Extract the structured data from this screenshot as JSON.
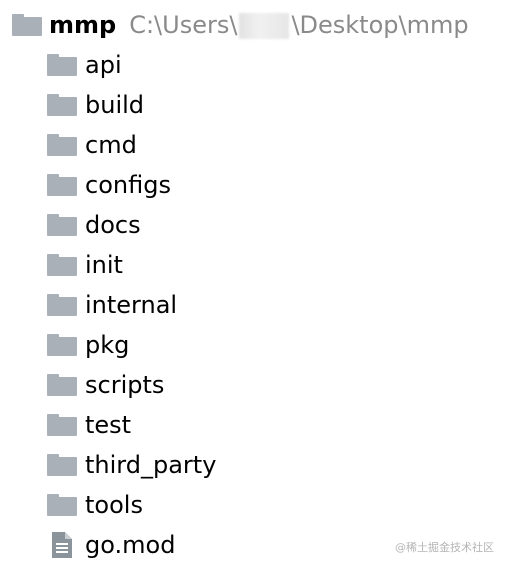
{
  "root": {
    "name": "mmp",
    "path_prefix": "C:\\Users\\",
    "path_suffix": "\\Desktop\\mmp",
    "icon": "folder-icon"
  },
  "items": [
    {
      "label": "api",
      "type": "folder",
      "icon": "folder-icon"
    },
    {
      "label": "build",
      "type": "folder",
      "icon": "folder-icon"
    },
    {
      "label": "cmd",
      "type": "folder",
      "icon": "folder-icon"
    },
    {
      "label": "configs",
      "type": "folder",
      "icon": "folder-icon"
    },
    {
      "label": "docs",
      "type": "folder",
      "icon": "folder-icon"
    },
    {
      "label": "init",
      "type": "folder",
      "icon": "folder-icon"
    },
    {
      "label": "internal",
      "type": "folder",
      "icon": "folder-icon"
    },
    {
      "label": "pkg",
      "type": "folder",
      "icon": "folder-icon"
    },
    {
      "label": "scripts",
      "type": "folder",
      "icon": "folder-icon"
    },
    {
      "label": "test",
      "type": "folder",
      "icon": "folder-icon"
    },
    {
      "label": "third_party",
      "type": "folder",
      "icon": "folder-icon"
    },
    {
      "label": "tools",
      "type": "folder",
      "icon": "folder-icon"
    },
    {
      "label": "go.mod",
      "type": "file",
      "icon": "file-icon"
    }
  ],
  "watermark": "@稀土掘金技术社区",
  "colors": {
    "folder": "#a9b0b8",
    "file": "#8b939b",
    "path_text": "#8a8a8a"
  }
}
